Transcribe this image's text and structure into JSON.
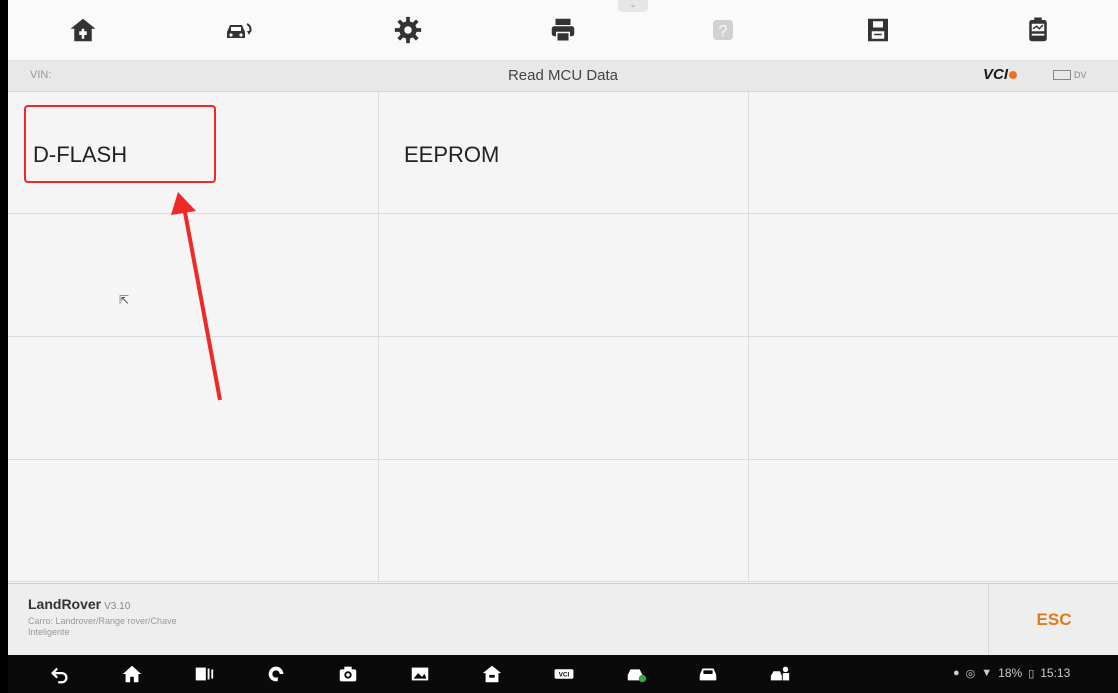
{
  "header": {
    "vin_label": "VIN:",
    "title": "Read MCU Data",
    "vci_label": "VCI",
    "battery_label": "DV"
  },
  "toolbar": {
    "icons": [
      "home-icon",
      "vehicle-swap-icon",
      "settings-icon",
      "print-icon",
      "help-icon",
      "save-icon",
      "report-icon"
    ]
  },
  "grid": {
    "items": [
      "D-FLASH",
      "EEPROM",
      "",
      "",
      "",
      "",
      "",
      "",
      "",
      "",
      "",
      ""
    ]
  },
  "footer": {
    "app_name": "LandRover",
    "version": "V3.10",
    "path_line1": "Carro: Landrover/Range rover/Chave",
    "path_line2": "Inteligente",
    "esc_label": "ESC"
  },
  "status": {
    "battery": "18%",
    "time": "15:13"
  },
  "colors": {
    "highlight": "#f02828",
    "esc": "#e07a20",
    "vci_dot": "#f07020"
  }
}
